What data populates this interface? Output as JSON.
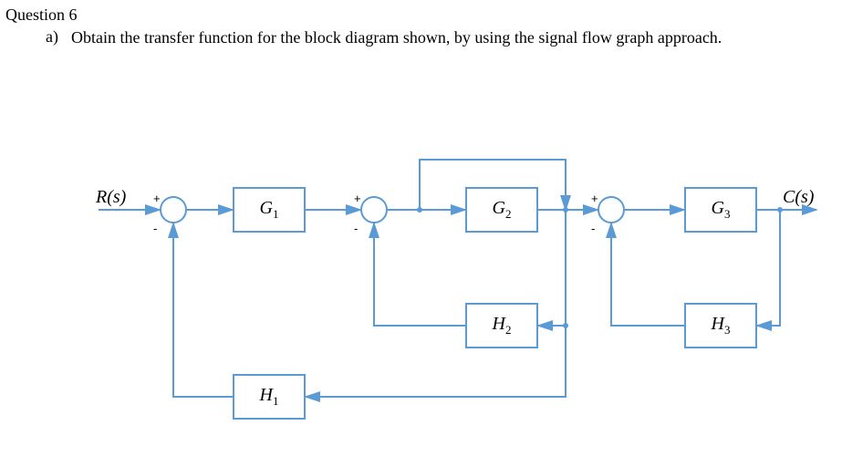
{
  "question": {
    "header": "Question 6",
    "part_label": "a)",
    "part_text": "Obtain the transfer function for the block diagram shown, by using the signal flow graph approach."
  },
  "diagram": {
    "input_label": "R(s)",
    "output_label": "C(s)",
    "blocks": {
      "g1": "G",
      "g1_sub": "1",
      "g2": "G",
      "g2_sub": "2",
      "g3": "G",
      "g3_sub": "3",
      "h1": "H",
      "h1_sub": "1",
      "h2": "H",
      "h2_sub": "2",
      "h3": "H",
      "h3_sub": "3"
    },
    "summers": {
      "s1": {
        "plus": "+",
        "minus": "-"
      },
      "s2": {
        "plus": "+",
        "minus": "-"
      },
      "s3": {
        "plus": "+",
        "minus": "-"
      }
    }
  }
}
